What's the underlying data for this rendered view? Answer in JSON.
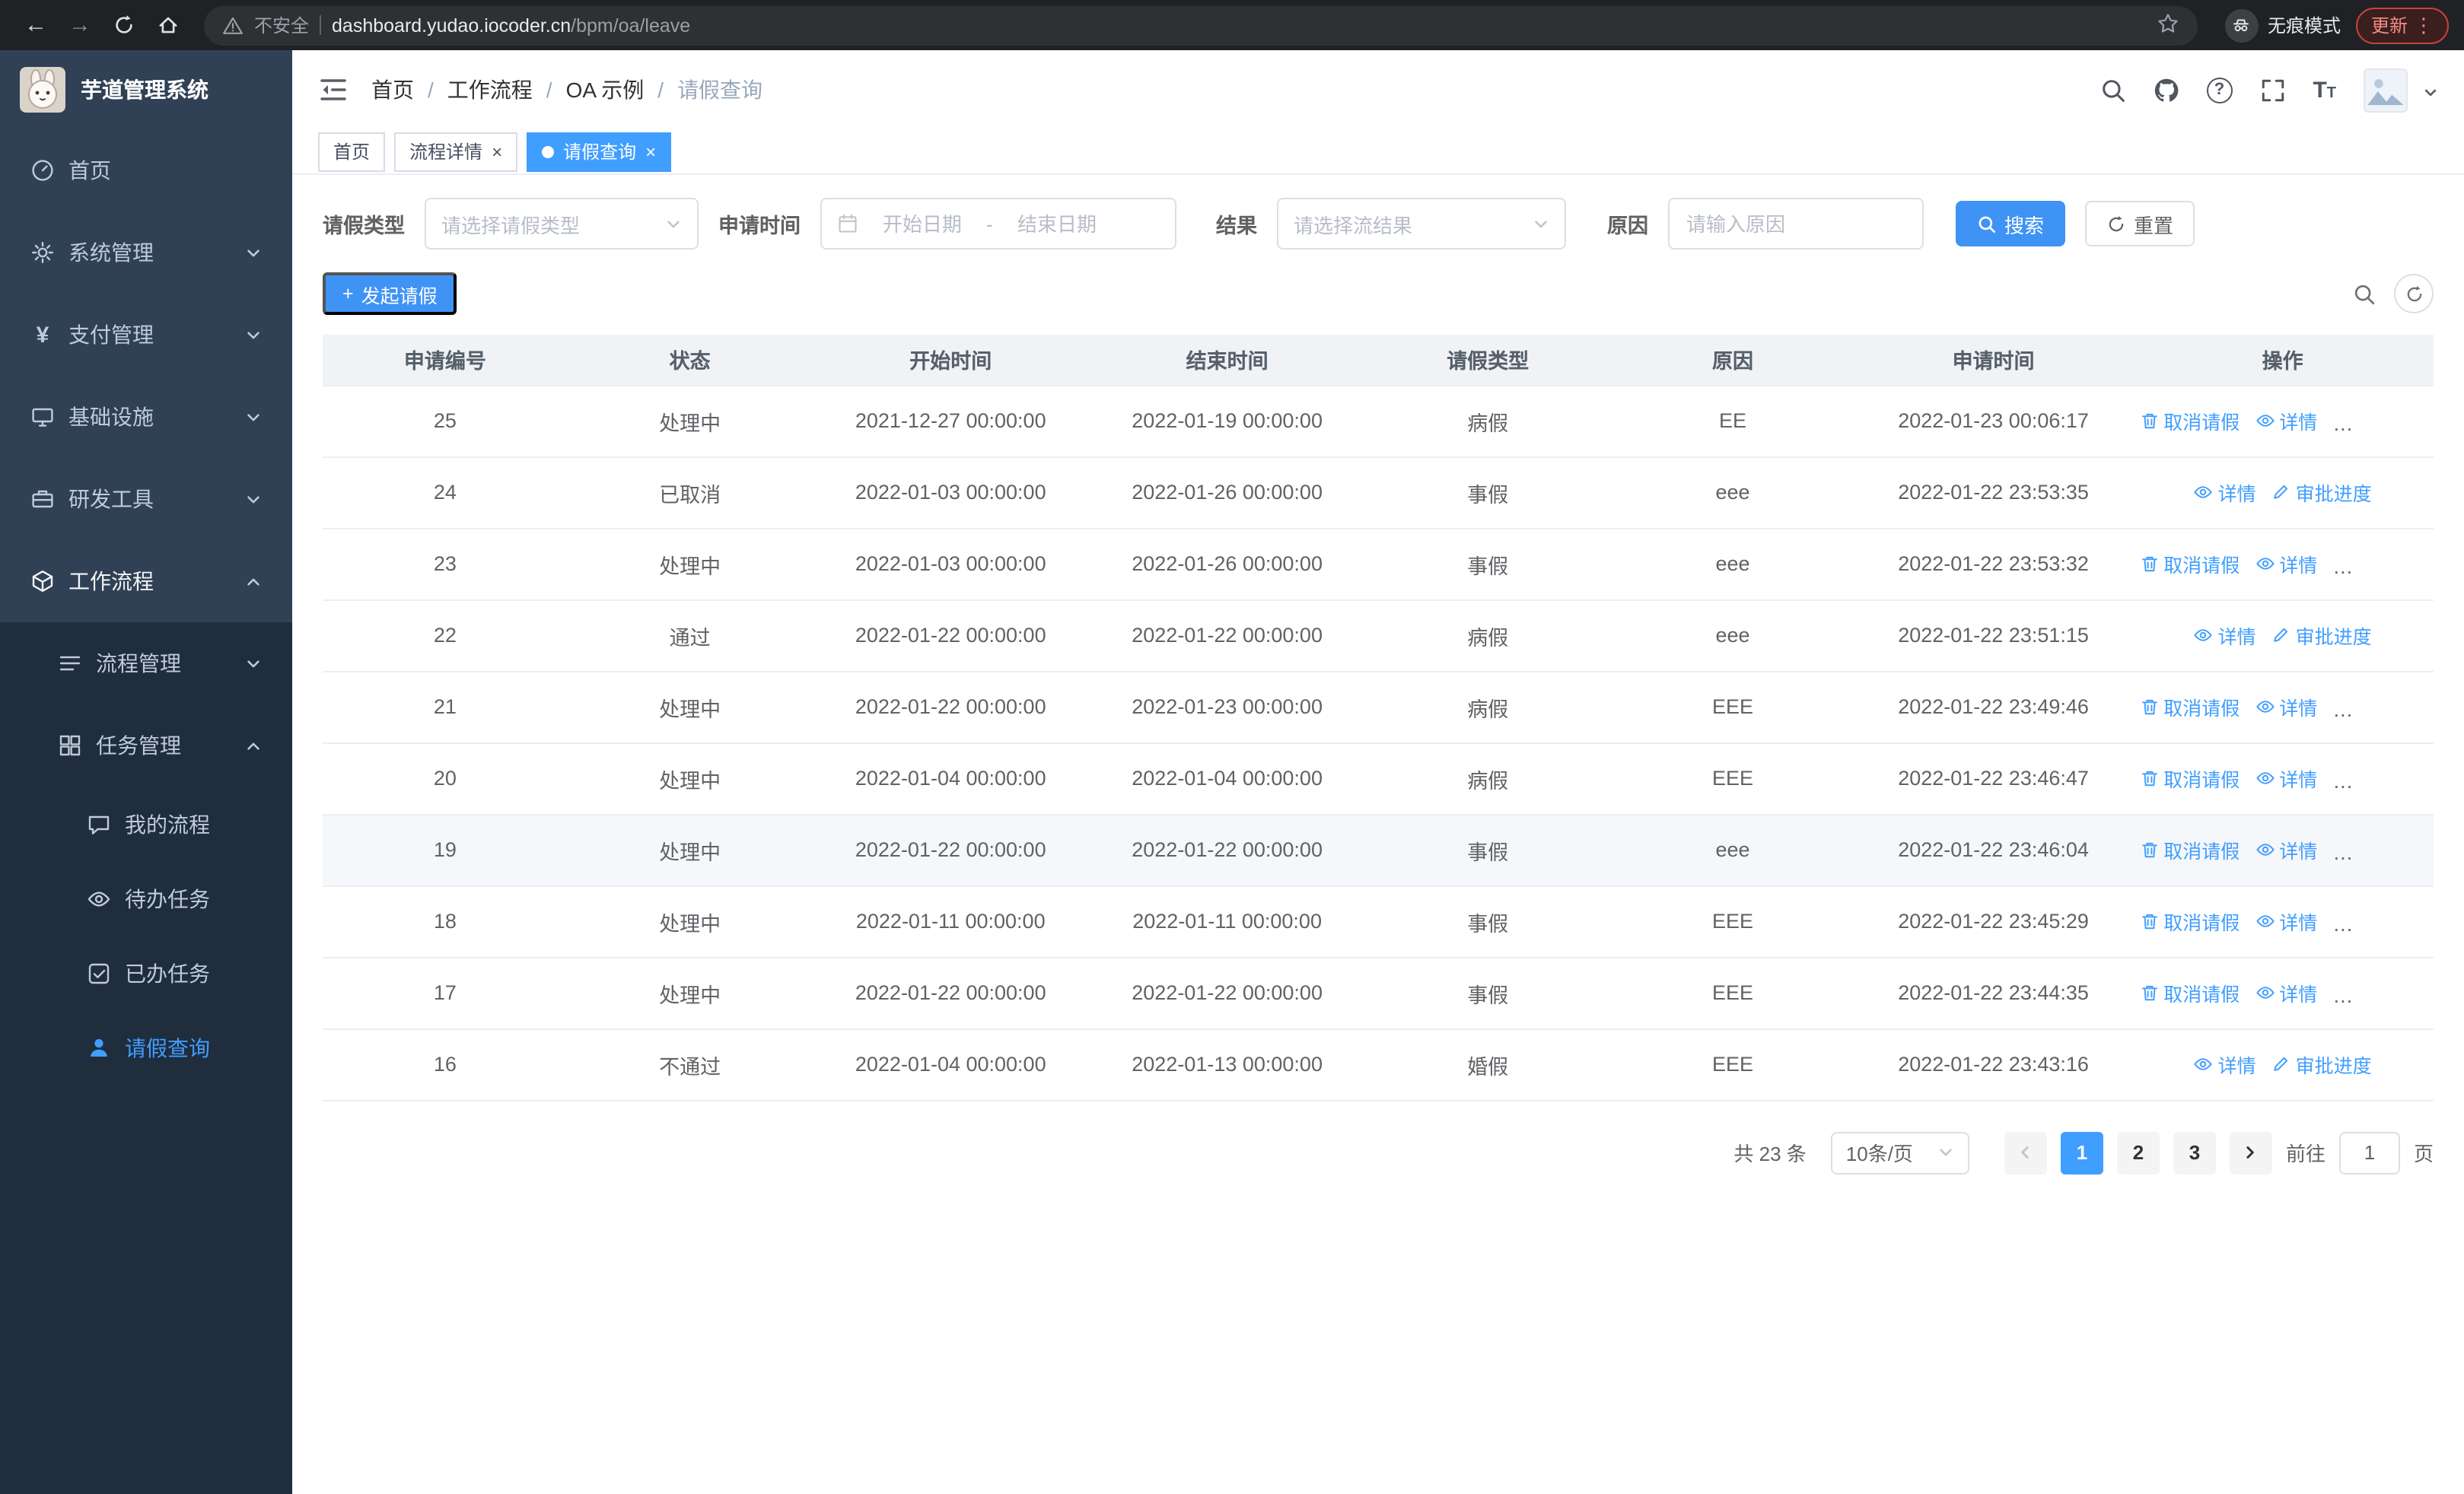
{
  "colors": {
    "primary": "#409eff",
    "sidebar_bg": "#304156",
    "submenu_bg": "#1f2d3d",
    "chrome_bg": "#202124"
  },
  "icons": {
    "close": "×",
    "menu_dots": "⋮",
    "plus": "+",
    "back": "←",
    "forward": "→",
    "yen": "¥"
  },
  "browser": {
    "security_label": "不安全",
    "url_domain": "dashboard.yudao.iocoder.cn",
    "url_path": "/bpm/oa/leave",
    "incognito_label": "无痕模式",
    "update_label": "更新"
  },
  "sidebar": {
    "title": "芋道管理系统",
    "items": [
      {
        "label": "首页"
      },
      {
        "label": "系统管理"
      },
      {
        "label": "支付管理"
      },
      {
        "label": "基础设施"
      },
      {
        "label": "研发工具"
      },
      {
        "label": "工作流程"
      }
    ],
    "submenu_items": [
      {
        "label": "流程管理"
      },
      {
        "label": "任务管理"
      }
    ],
    "task_children": [
      {
        "label": "我的流程"
      },
      {
        "label": "待办任务"
      },
      {
        "label": "已办任务"
      },
      {
        "label": "请假查询"
      }
    ]
  },
  "header": {
    "separator": "/",
    "breadcrumb": [
      "首页",
      "工作流程",
      "OA 示例",
      "请假查询"
    ],
    "help_glyph": "?"
  },
  "tabs": [
    {
      "label": "首页"
    },
    {
      "label": "流程详情"
    },
    {
      "label": "请假查询"
    }
  ],
  "filters": {
    "type_label": "请假类型",
    "type_placeholder": "请选择请假类型",
    "time_label": "申请时间",
    "start_placeholder": "开始日期",
    "range_separator": "-",
    "end_placeholder": "结束日期",
    "result_label": "结果",
    "result_placeholder": "请选择流结果",
    "reason_label": "原因",
    "reason_placeholder": "请输入原因",
    "search_button": "搜索",
    "reset_button": "重置"
  },
  "toolbar": {
    "create_button": "发起请假"
  },
  "table": {
    "columns": [
      "申请编号",
      "状态",
      "开始时间",
      "结束时间",
      "请假类型",
      "原因",
      "申请时间",
      "操作"
    ],
    "action_labels": {
      "cancel": "取消请假",
      "detail": "详情",
      "progress": "审批进度"
    },
    "highlighted_row_id": "19",
    "rows": [
      {
        "id": "25",
        "status": "处理中",
        "start": "2021-12-27 00:00:00",
        "end": "2022-01-19 00:00:00",
        "type": "病假",
        "reason": "EE",
        "apply_time": "2022-01-23 00:06:17",
        "actions": [
          "cancel",
          "detail",
          "progress"
        ]
      },
      {
        "id": "24",
        "status": "已取消",
        "start": "2022-01-03 00:00:00",
        "end": "2022-01-26 00:00:00",
        "type": "事假",
        "reason": "eee",
        "apply_time": "2022-01-22 23:53:35",
        "actions": [
          "detail",
          "progress"
        ]
      },
      {
        "id": "23",
        "status": "处理中",
        "start": "2022-01-03 00:00:00",
        "end": "2022-01-26 00:00:00",
        "type": "事假",
        "reason": "eee",
        "apply_time": "2022-01-22 23:53:32",
        "actions": [
          "cancel",
          "detail",
          "progress"
        ]
      },
      {
        "id": "22",
        "status": "通过",
        "start": "2022-01-22 00:00:00",
        "end": "2022-01-22 00:00:00",
        "type": "病假",
        "reason": "eee",
        "apply_time": "2022-01-22 23:51:15",
        "actions": [
          "detail",
          "progress"
        ]
      },
      {
        "id": "21",
        "status": "处理中",
        "start": "2022-01-22 00:00:00",
        "end": "2022-01-23 00:00:00",
        "type": "病假",
        "reason": "EEE",
        "apply_time": "2022-01-22 23:49:46",
        "actions": [
          "cancel",
          "detail",
          "progress"
        ]
      },
      {
        "id": "20",
        "status": "处理中",
        "start": "2022-01-04 00:00:00",
        "end": "2022-01-04 00:00:00",
        "type": "病假",
        "reason": "EEE",
        "apply_time": "2022-01-22 23:46:47",
        "actions": [
          "cancel",
          "detail",
          "progress"
        ]
      },
      {
        "id": "19",
        "status": "处理中",
        "start": "2022-01-22 00:00:00",
        "end": "2022-01-22 00:00:00",
        "type": "事假",
        "reason": "eee",
        "apply_time": "2022-01-22 23:46:04",
        "actions": [
          "cancel",
          "detail",
          "progress"
        ]
      },
      {
        "id": "18",
        "status": "处理中",
        "start": "2022-01-11 00:00:00",
        "end": "2022-01-11 00:00:00",
        "type": "事假",
        "reason": "EEE",
        "apply_time": "2022-01-22 23:45:29",
        "actions": [
          "cancel",
          "detail",
          "progress"
        ]
      },
      {
        "id": "17",
        "status": "处理中",
        "start": "2022-01-22 00:00:00",
        "end": "2022-01-22 00:00:00",
        "type": "事假",
        "reason": "EEE",
        "apply_time": "2022-01-22 23:44:35",
        "actions": [
          "cancel",
          "detail",
          "progress"
        ]
      },
      {
        "id": "16",
        "status": "不通过",
        "start": "2022-01-04 00:00:00",
        "end": "2022-01-13 00:00:00",
        "type": "婚假",
        "reason": "EEE",
        "apply_time": "2022-01-22 23:43:16",
        "actions": [
          "detail",
          "progress"
        ]
      }
    ]
  },
  "pagination": {
    "total_text": "共 23 条",
    "page_size_text": "10条/页",
    "pages": [
      "1",
      "2",
      "3"
    ],
    "active_page": "1",
    "goto_label": "前往",
    "goto_value": "1",
    "page_unit": "页"
  }
}
